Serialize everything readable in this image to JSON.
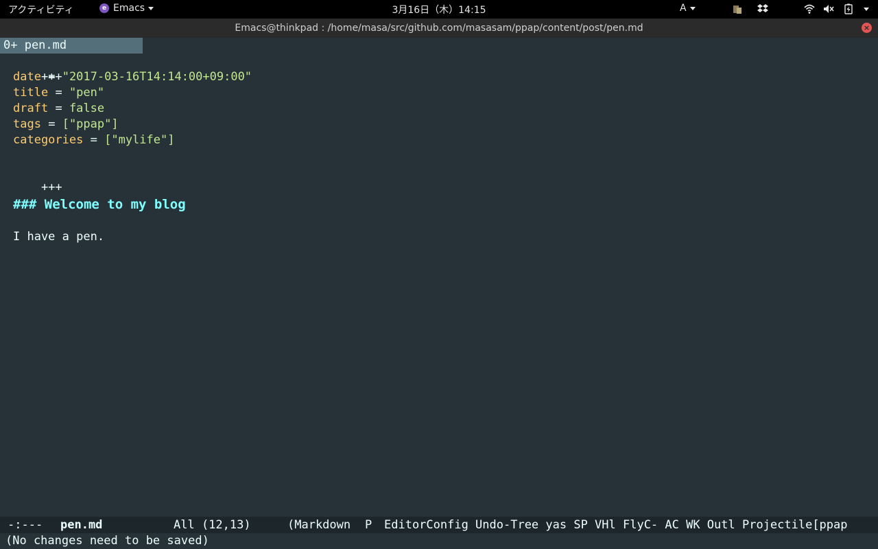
{
  "topbar": {
    "activities": "アクティビティ",
    "app_name": "Emacs",
    "clock": "3月16日（木）14:15",
    "input_method": "A"
  },
  "window": {
    "title": "Emacs@thinkpad : /home/masa/src/github.com/masasam/ppap/content/post/pen.md"
  },
  "tabline": {
    "tab_label": "0+ pen.md"
  },
  "buffer": {
    "line1": "+++",
    "date_key": "date",
    "date_value": "\"2017-03-16T14:14:00+09:00\"",
    "title_key": "title",
    "title_value": "\"pen\"",
    "draft_key": "draft",
    "draft_value": "false",
    "tags_key": "tags",
    "tags_value": "[\"ppap\"]",
    "categories_key": "categories",
    "categories_value": "[\"mylife\"]",
    "line8": "+++",
    "heading": "### Welcome to my blog",
    "paragraph": "I have a pen.",
    "equals": "="
  },
  "modeline": {
    "status": "-:---",
    "buffer_name": "pen.md",
    "position": "All (12,13)",
    "modes": "(Markdown",
    "p_indicator": "P",
    "minor_modes": "EditorConfig Undo-Tree yas SP VHl FlyC- AC WK Outl Projectile[ppap"
  },
  "echo": {
    "message": "(No changes need to be saved)"
  },
  "colors": {
    "background": "#263238",
    "key": "#ffcb6b",
    "string": "#c3e88d",
    "heading": "#80ffff",
    "tab_bg": "#546e7a"
  }
}
